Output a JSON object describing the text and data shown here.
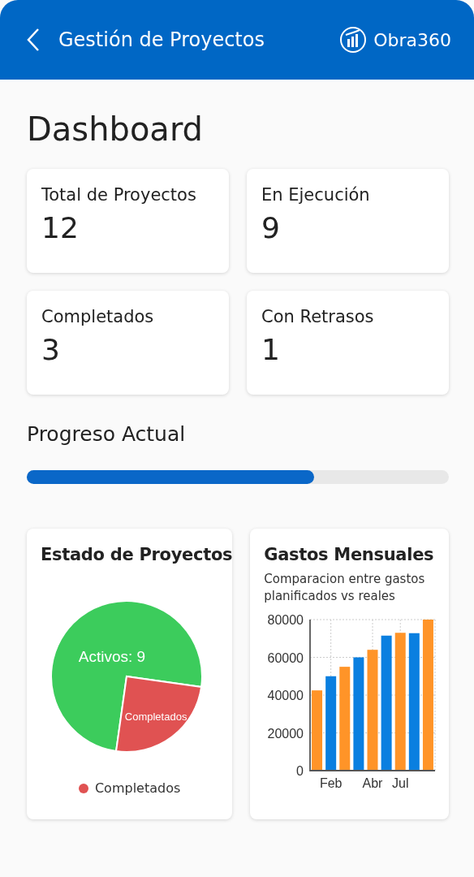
{
  "header": {
    "title": "Gestión de Proyectos",
    "brand": "Obra360"
  },
  "page_title": "Dashboard",
  "stats": [
    {
      "label": "Total de Proyectos",
      "value": "12"
    },
    {
      "label": "En Ejecución",
      "value": "9"
    },
    {
      "label": "Completados",
      "value": "3"
    },
    {
      "label": "Con Retrasos",
      "value": "1"
    }
  ],
  "progress": {
    "label": "Progreso Actual",
    "level": 0.68
  },
  "status_card": {
    "title": "Estado de Proyectos",
    "legend": [
      {
        "label": "Completados",
        "color": "#e05252"
      }
    ],
    "chart_data": {
      "type": "pie",
      "values": [
        9,
        3
      ],
      "value_labels": [
        "Activos: 9",
        "Completados"
      ],
      "colors": [
        "#3ccc5c",
        "#e05252"
      ]
    }
  },
  "expenses_card": {
    "title": "Gastos Mensuales",
    "subtitle": "Comparacion entre gastos planificados vs reales",
    "chart_data": {
      "type": "bar",
      "categories": [
        null,
        "Feb",
        null,
        null,
        "Abr",
        null,
        "Jul",
        null,
        null
      ],
      "grid": true,
      "series": [
        {
          "color": "#ff9428",
          "values": [
            42500,
            null,
            55000,
            null,
            64000,
            null,
            73000,
            null,
            80000
          ]
        },
        {
          "color": "#0a7fe0",
          "values": [
            null,
            50000,
            null,
            60000,
            null,
            71500,
            null,
            72800,
            null
          ]
        }
      ],
      "ylim": [
        0,
        80000
      ],
      "yticks": [
        0,
        20000,
        40000,
        60000,
        80000
      ]
    }
  }
}
